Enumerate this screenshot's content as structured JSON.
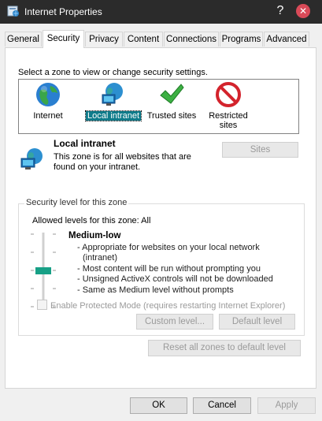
{
  "window": {
    "title": "Internet Properties",
    "help_glyph": "?",
    "close_glyph": "✕"
  },
  "tabs": [
    {
      "label": "General"
    },
    {
      "label": "Security",
      "active": true
    },
    {
      "label": "Privacy"
    },
    {
      "label": "Content"
    },
    {
      "label": "Connections"
    },
    {
      "label": "Programs"
    },
    {
      "label": "Advanced"
    }
  ],
  "security": {
    "select_zone_label": "Select a zone to view or change security settings.",
    "zones": [
      {
        "label": "Internet",
        "icon": "globe-icon"
      },
      {
        "label": "Local intranet",
        "icon": "intranet-icon",
        "selected": true
      },
      {
        "label": "Trusted sites",
        "icon": "checkmark-icon"
      },
      {
        "label": "Restricted sites",
        "icon": "restricted-icon"
      }
    ],
    "zone_info": {
      "title": "Local intranet",
      "description": "This zone is for all websites that are found on your intranet.",
      "sites_button": "Sites"
    },
    "level_group": {
      "title": "Security level for this zone",
      "allowed_label": "Allowed levels for this zone: All",
      "level_name": "Medium-low",
      "level_items": [
        "- Appropriate for websites on your local network",
        "(intranet)",
        "- Most content will be run without prompting you",
        "- Unsigned ActiveX controls will not be downloaded",
        "- Same as Medium level without prompts"
      ],
      "protected_mode_label": "Enable Protected Mode (requires restarting Internet Explorer)",
      "custom_level_button": "Custom level...",
      "default_level_button": "Default level"
    },
    "reset_all_button": "Reset all zones to default level"
  },
  "footer": {
    "ok": "OK",
    "cancel": "Cancel",
    "apply": "Apply"
  },
  "colors": {
    "selected_zone_bg": "#0f7b8a",
    "slider_thumb": "#17a086",
    "titlebar_bg": "#2b2b2b",
    "close_button": "#d94a58"
  }
}
